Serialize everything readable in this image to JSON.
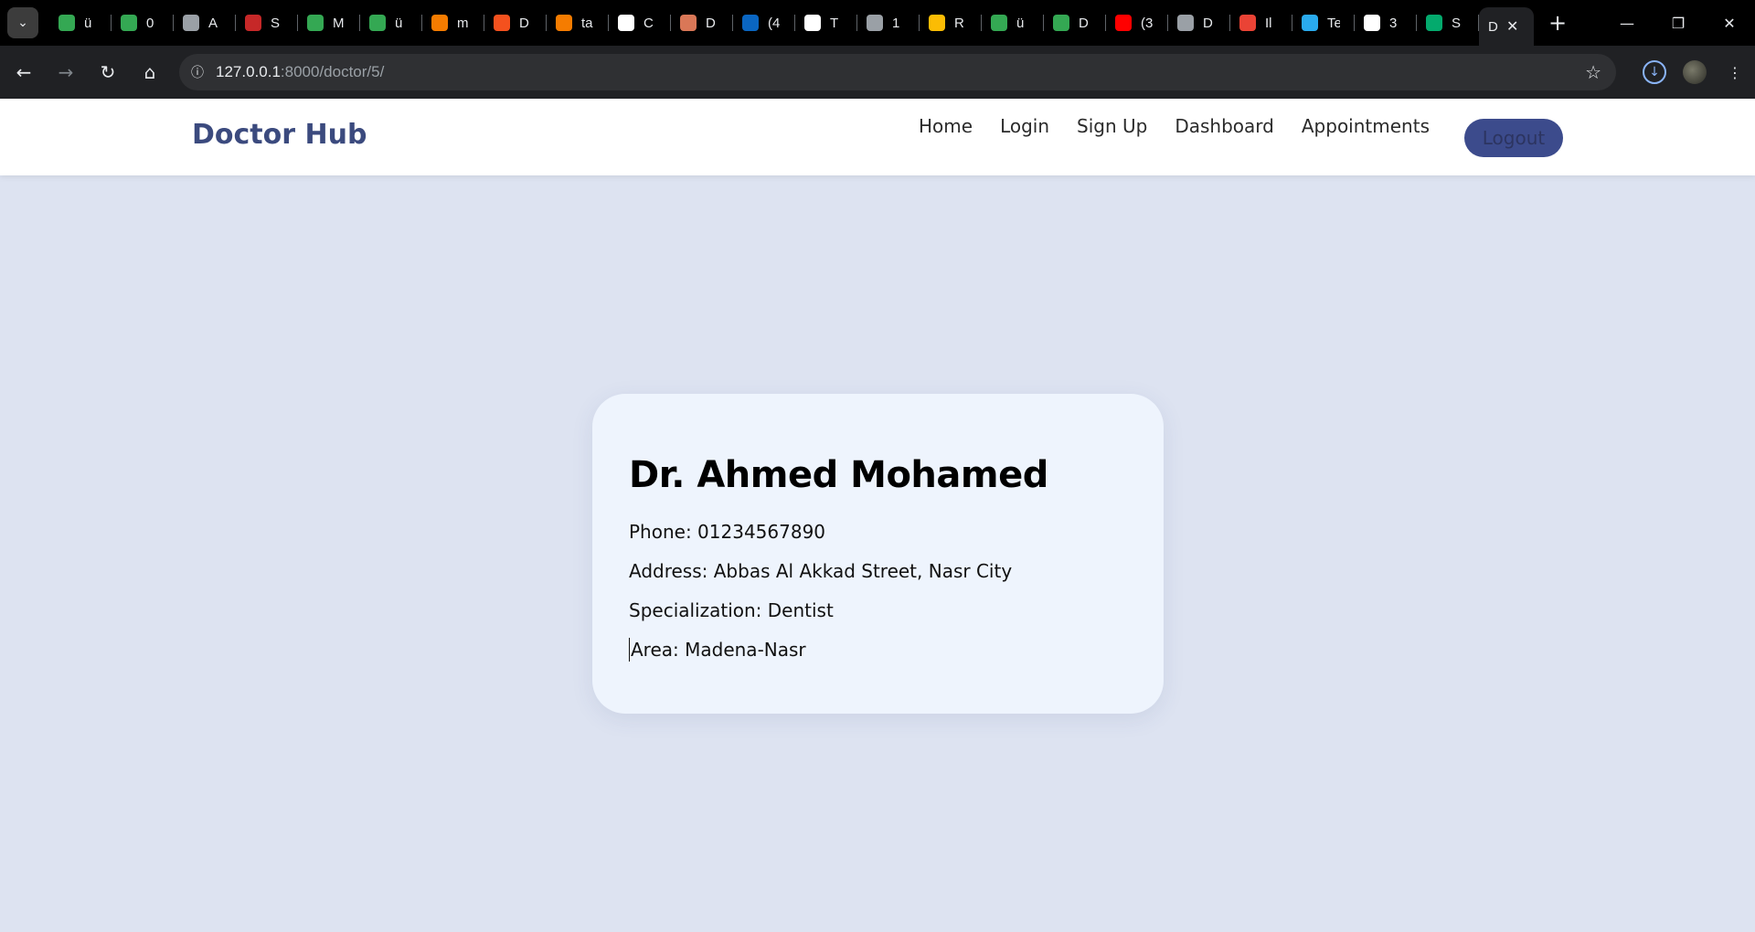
{
  "browser": {
    "tabs": [
      {
        "icon": "google-drive-icon",
        "title": "ü",
        "color": "#34a853"
      },
      {
        "icon": "google-drive-icon",
        "title": "0",
        "color": "#34a853"
      },
      {
        "icon": "openai-icon",
        "title": "A",
        "color": "#9aa0a6"
      },
      {
        "icon": "site-icon",
        "title": "S",
        "color": "#c62828"
      },
      {
        "icon": "google-drive-icon",
        "title": "M",
        "color": "#34a853"
      },
      {
        "icon": "google-drive-icon",
        "title": "ü",
        "color": "#34a853"
      },
      {
        "icon": "book-icon",
        "title": "m",
        "color": "#f57c00"
      },
      {
        "icon": "ring-icon",
        "title": "D",
        "color": "#f4511e"
      },
      {
        "icon": "book-icon",
        "title": "ta",
        "color": "#f57c00"
      },
      {
        "icon": "github-icon",
        "title": "C",
        "color": "#ffffff"
      },
      {
        "icon": "claude-icon",
        "title": "D",
        "color": "#d97757"
      },
      {
        "icon": "linkedin-icon",
        "title": "(4",
        "color": "#0a66c2"
      },
      {
        "icon": "circle-icon",
        "title": "T",
        "color": "#ffffff"
      },
      {
        "icon": "globe-icon",
        "title": "1",
        "color": "#9aa0a6"
      },
      {
        "icon": "arrow-icon",
        "title": "R",
        "color": "#fbbc04"
      },
      {
        "icon": "google-drive-icon",
        "title": "ü",
        "color": "#34a853"
      },
      {
        "icon": "google-drive-icon",
        "title": "D",
        "color": "#34a853"
      },
      {
        "icon": "youtube-icon",
        "title": "(3",
        "color": "#ff0000"
      },
      {
        "icon": "globe-icon",
        "title": "D",
        "color": "#9aa0a6"
      },
      {
        "icon": "gmail-icon",
        "title": "Il",
        "color": "#ea4335"
      },
      {
        "icon": "telegram-icon",
        "title": "Te",
        "color": "#2aabee"
      },
      {
        "icon": "f-icon",
        "title": "3",
        "color": "#ffffff"
      },
      {
        "icon": "w3schools-icon",
        "title": "S",
        "color": "#04aa6d"
      }
    ],
    "active_tab": {
      "title": "D"
    },
    "url_host": "127.0.0.1",
    "url_path": ":8000/doctor/5/"
  },
  "site": {
    "brand": "Doctor Hub",
    "nav": [
      "Home",
      "Login",
      "Sign Up",
      "Dashboard",
      "Appointments"
    ],
    "logout_label": "Logout",
    "colors": {
      "brand": "#3b4a7e",
      "button": "#3c4b8c",
      "background": "#dde3f1",
      "card": "#eef4fd"
    }
  },
  "doctor": {
    "name": "Dr. Ahmed Mohamed",
    "phone": "Phone: 01234567890",
    "address": "Address: Abbas Al Akkad Street, Nasr City",
    "specialization": "Specialization: Dentist",
    "area": "Area: Madena-Nasr"
  }
}
